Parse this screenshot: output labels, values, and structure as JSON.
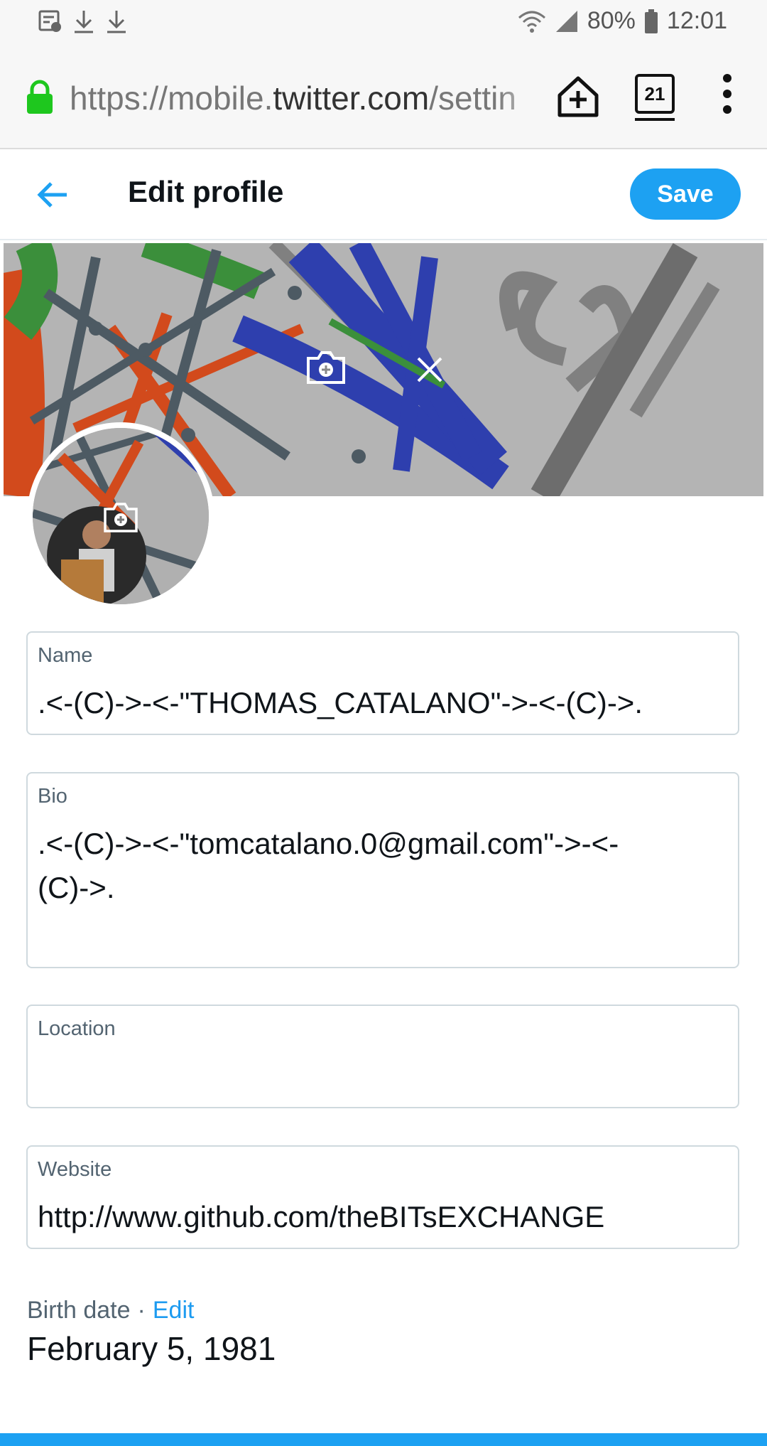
{
  "status_bar": {
    "battery": "80%",
    "time": "12:01",
    "left_icons": [
      "notification-icon",
      "download-icon",
      "download-icon"
    ],
    "right_icons": [
      "wifi-icon",
      "signal-icon",
      "battery-icon"
    ]
  },
  "browser": {
    "url_scheme_prefix": "https://mobile.",
    "url_host": "twitter.com",
    "url_path": "/settin",
    "tab_count": "21",
    "icons": [
      "lock-icon",
      "home-add-icon",
      "tabs-icon",
      "overflow-menu-icon"
    ]
  },
  "header": {
    "title": "Edit profile",
    "save_label": "Save",
    "back_icon": "back-arrow-icon",
    "accent_color": "#1da1f2"
  },
  "banner": {
    "icons": [
      "camera-add-icon",
      "close-icon"
    ]
  },
  "avatar": {
    "icon": "camera-add-icon"
  },
  "form": {
    "name": {
      "label": "Name",
      "value": ".<-(C)->-<-\"THOMAS_CATALANO\"->-<-(C)->."
    },
    "bio": {
      "label": "Bio",
      "value": ".<-(C)->-<-\"tomcatalano.0@gmail.com\"->-<-(C)->."
    },
    "location": {
      "label": "Location",
      "value": ""
    },
    "website": {
      "label": "Website",
      "value": "http://www.github.com/theBITsEXCHANGE"
    },
    "birth_date": {
      "label": "Birth date",
      "separator": "·",
      "edit_label": "Edit",
      "value": "February 5, 1981"
    }
  }
}
